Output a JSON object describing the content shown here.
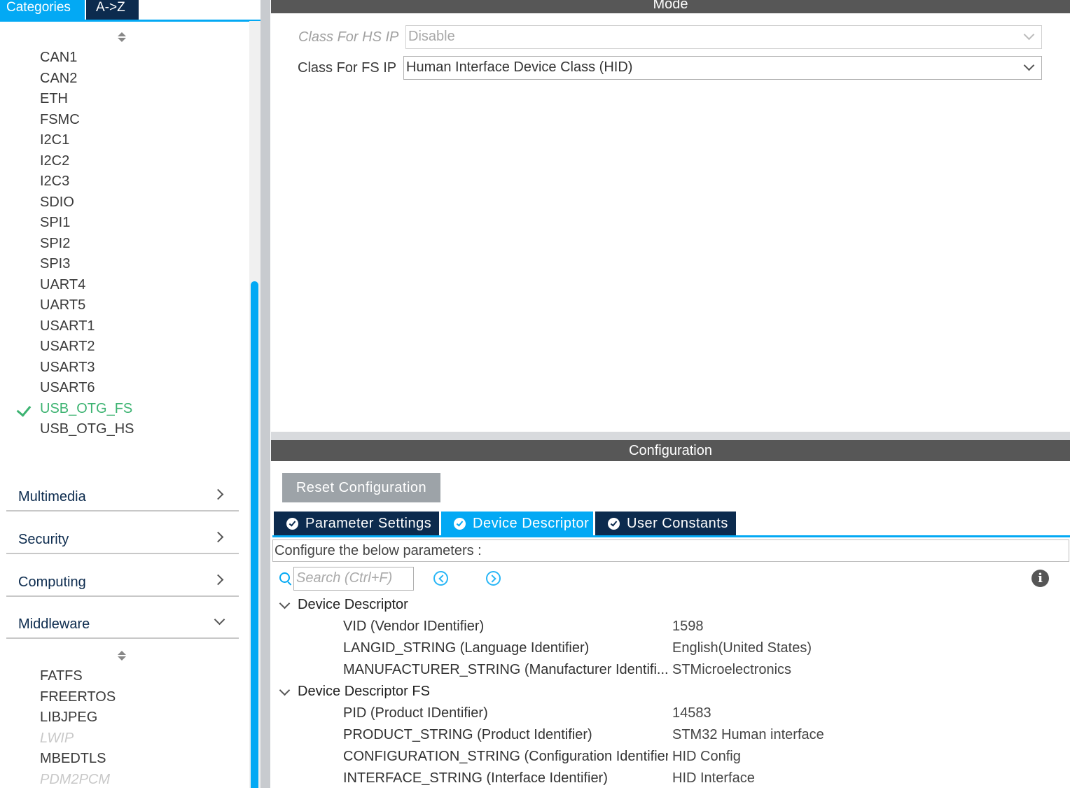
{
  "left_tabs": {
    "categories": "Categories",
    "az": "A->Z"
  },
  "connectivity_items": [
    {
      "label": "CAN1"
    },
    {
      "label": "CAN2"
    },
    {
      "label": "ETH"
    },
    {
      "label": "FSMC"
    },
    {
      "label": "I2C1"
    },
    {
      "label": "I2C2"
    },
    {
      "label": "I2C3"
    },
    {
      "label": "SDIO"
    },
    {
      "label": "SPI1"
    },
    {
      "label": "SPI2"
    },
    {
      "label": "SPI3"
    },
    {
      "label": "UART4"
    },
    {
      "label": "UART5"
    },
    {
      "label": "USART1"
    },
    {
      "label": "USART2"
    },
    {
      "label": "USART3"
    },
    {
      "label": "USART6"
    },
    {
      "label": "USB_OTG_FS",
      "state": "enabled"
    },
    {
      "label": "USB_OTG_HS"
    }
  ],
  "groups": {
    "multimedia": "Multimedia",
    "security": "Security",
    "computing": "Computing",
    "middleware": "Middleware"
  },
  "middleware_items": [
    {
      "label": "FATFS"
    },
    {
      "label": "FREERTOS"
    },
    {
      "label": "LIBJPEG"
    },
    {
      "label": "LWIP",
      "state": "disabled"
    },
    {
      "label": "MBEDTLS"
    },
    {
      "label": "PDM2PCM",
      "state": "disabled"
    }
  ],
  "mode": {
    "header": "Mode",
    "hs_label": "Class For HS IP",
    "hs_value": "Disable",
    "fs_label": "Class For FS IP",
    "fs_value": "Human Interface Device Class (HID)"
  },
  "configuration": {
    "header": "Configuration",
    "reset_label": "Reset Configuration",
    "tabs": [
      {
        "label": "Parameter Settings"
      },
      {
        "label": "Device Descriptor",
        "active": true
      },
      {
        "label": "User Constants"
      }
    ],
    "info_text": "Configure the below parameters :",
    "search_placeholder": "Search (Ctrl+F)",
    "info_icon_glyph": "i",
    "sections": [
      {
        "title": "Device Descriptor",
        "rows": [
          {
            "name": "VID (Vendor IDentifier)",
            "value": "1598"
          },
          {
            "name": "LANGID_STRING (Language Identifier)",
            "value": "English(United States)"
          },
          {
            "name": "MANUFACTURER_STRING (Manufacturer Identifi...",
            "value": "STMicroelectronics"
          }
        ]
      },
      {
        "title": "Device Descriptor FS",
        "rows": [
          {
            "name": "PID (Product IDentifier)",
            "value": "14583"
          },
          {
            "name": "PRODUCT_STRING (Product Identifier)",
            "value": "STM32 Human interface"
          },
          {
            "name": "CONFIGURATION_STRING (Configuration Identifier)",
            "value": "HID Config"
          },
          {
            "name": "INTERFACE_STRING (Interface Identifier)",
            "value": "HID Interface"
          }
        ]
      }
    ]
  },
  "colors": {
    "accent": "#03a9f4",
    "navy": "#0c2b4e",
    "enabled": "#3cb371",
    "header": "#575757"
  }
}
